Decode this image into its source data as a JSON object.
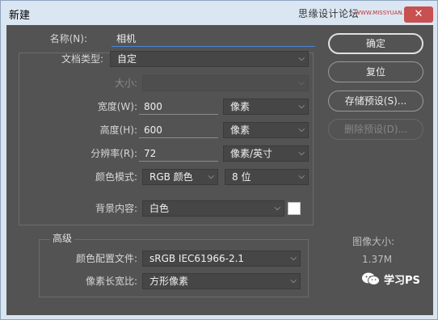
{
  "window": {
    "title": "新建",
    "watermark": "思缘设计论坛",
    "watermark_sub": "WWW.MISSYUAN.COM",
    "close_glyph": "✕"
  },
  "name": {
    "label": "名称(N):",
    "value": "相机"
  },
  "doc_type": {
    "label": "文档类型:",
    "value": "自定"
  },
  "size": {
    "label": "大小:",
    "value": ""
  },
  "width": {
    "label": "宽度(W):",
    "value": "800",
    "unit": "像素"
  },
  "height": {
    "label": "高度(H):",
    "value": "600",
    "unit": "像素"
  },
  "resolution": {
    "label": "分辨率(R):",
    "value": "72",
    "unit": "像素/英寸"
  },
  "color_mode": {
    "label": "颜色模式:",
    "mode": "RGB 颜色",
    "depth": "8 位"
  },
  "background": {
    "label": "背景内容:",
    "value": "白色",
    "swatch_color": "#ffffff"
  },
  "advanced": {
    "title": "高级",
    "profile_label": "颜色配置文件:",
    "profile_value": "sRGB IEC61966-2.1",
    "aspect_label": "像素长宽比:",
    "aspect_value": "方形像素"
  },
  "buttons": {
    "ok": "确定",
    "reset": "复位",
    "save_preset": "存储预设(S)...",
    "delete_preset": "删除预设(D)..."
  },
  "image_size": {
    "label": "图像大小:",
    "value": "1.37M"
  },
  "footer": {
    "text": "学习PS",
    "icon": "wechat-icon"
  },
  "colors": {
    "panel": "#535353",
    "titlebar": "#dbe6f3",
    "close": "#c85050",
    "focus": "#4b86d8"
  }
}
